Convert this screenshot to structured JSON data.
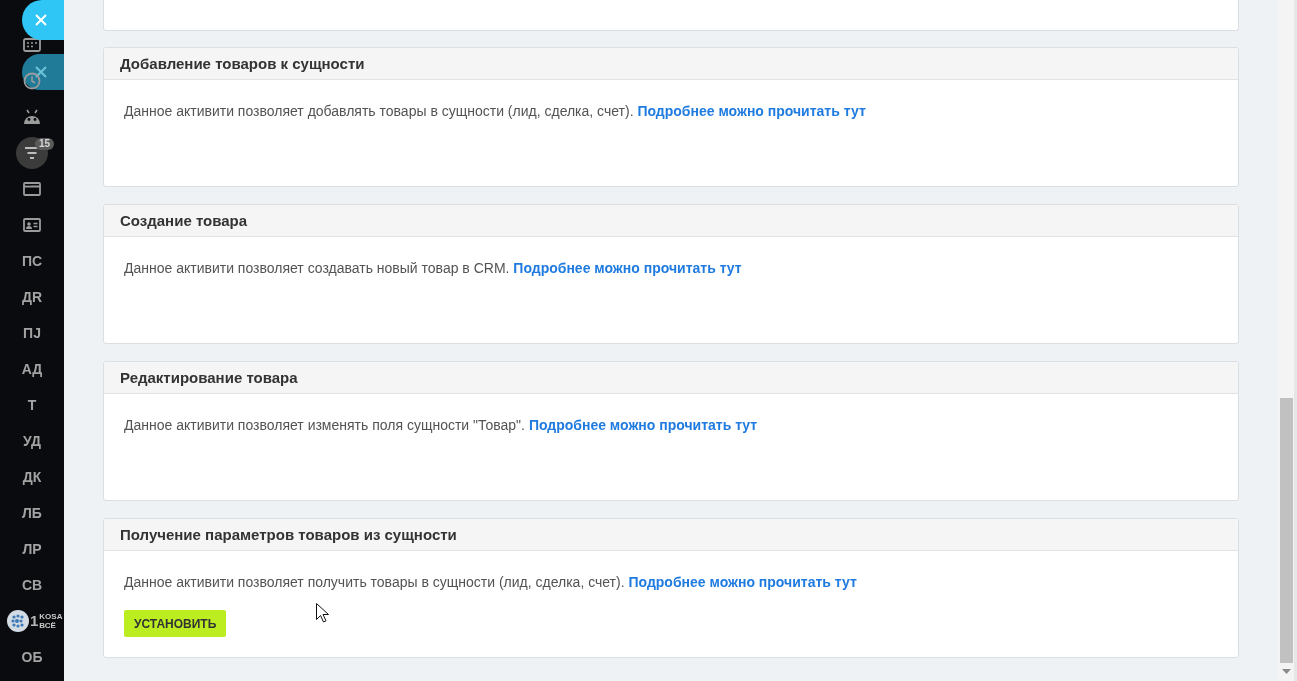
{
  "close_buttons": [
    {
      "dimmed": false
    },
    {
      "dimmed": true
    }
  ],
  "sidebar": {
    "items": [
      {
        "kind": "grid",
        "selected": false
      },
      {
        "kind": "clock",
        "selected": false
      },
      {
        "kind": "robot",
        "selected": false
      },
      {
        "kind": "funnel",
        "selected": true,
        "badge": "15"
      },
      {
        "kind": "window",
        "selected": false
      },
      {
        "kind": "card",
        "selected": false
      },
      {
        "kind": "text",
        "label": "ПС",
        "selected": false
      },
      {
        "kind": "text",
        "label": "ДR",
        "selected": false
      },
      {
        "kind": "text",
        "label": "ПJ",
        "selected": false
      },
      {
        "kind": "text",
        "label": "АД",
        "selected": false
      },
      {
        "kind": "text",
        "label": "Т",
        "selected": false
      },
      {
        "kind": "text",
        "label": "УД",
        "selected": false
      },
      {
        "kind": "text",
        "label": "ДК",
        "selected": false
      },
      {
        "kind": "text",
        "label": "ЛБ",
        "selected": false
      },
      {
        "kind": "text",
        "label": "ЛР",
        "selected": false
      },
      {
        "kind": "text",
        "label": "СВ",
        "selected": false
      },
      {
        "kind": "logo",
        "digit": "1",
        "lines": [
          "KOSA",
          "ВСЁ"
        ],
        "selected": false
      },
      {
        "kind": "text",
        "label": "ОБ",
        "selected": false
      }
    ]
  },
  "cards": [
    {
      "title": "Добавление товаров к сущности",
      "text": "Данное активити позволяет добавлять товары в сущности (лид, сделка, счет).",
      "link": "Подробнее можно прочитать тут"
    },
    {
      "title": "Создание товара",
      "text": "Данное активити позволяет создавать новый товар в CRM.",
      "link": "Подробнее можно прочитать тут"
    },
    {
      "title": "Редактирование товара",
      "text": "Данное активити позволяет изменять поля сущности \"Товар\".",
      "link": "Подробнее можно прочитать тут"
    },
    {
      "title": "Получение параметров товаров из сущности",
      "text": "Данное активити позволяет получить товары в сущности (лид, сделка, счет).",
      "link": "Подробнее можно прочитать тут",
      "button": "УСТАНОВИТЬ"
    }
  ]
}
